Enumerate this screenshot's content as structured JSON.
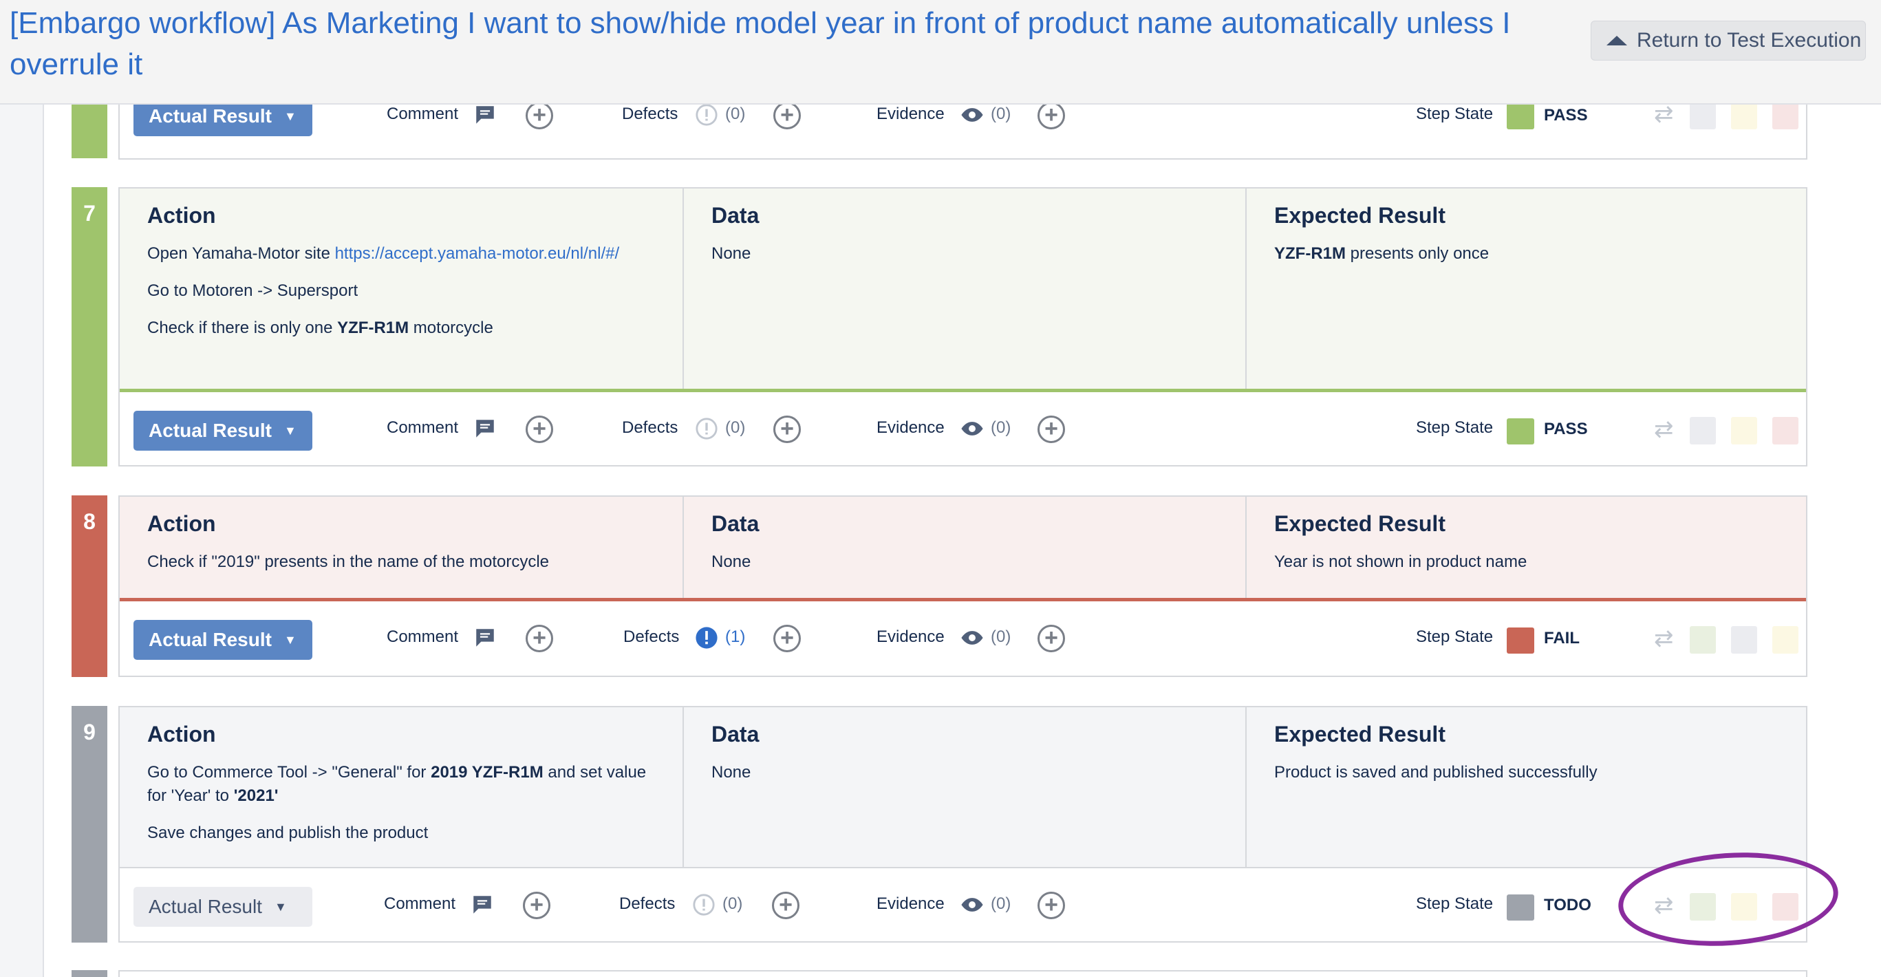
{
  "header": {
    "title": "[Embargo workflow] As Marketing I want to show/hide model year in front of product name automatically unless I overrule it",
    "return_button": "Return to Test Execution"
  },
  "labels": {
    "actual_result": "Actual Result",
    "comment": "Comment",
    "defects": "Defects",
    "evidence": "Evidence",
    "step_state": "Step State",
    "action": "Action",
    "data": "Data",
    "expected": "Expected Result"
  },
  "colors": {
    "pass": "#9fc46c",
    "fail": "#c96656",
    "todo": "#9ea3ab",
    "accent": "#5b86c4"
  },
  "step6": {
    "defects_count": "(0)",
    "evidence_count": "(0)",
    "state": "PASS"
  },
  "step7": {
    "number": "7",
    "action_prefix": "Open Yamaha-Motor site ",
    "action_link": "https://accept.yamaha-motor.eu/nl/nl/#/",
    "action_line2": "Go to Motoren -> Supersport",
    "action_line3_a": "Check if there is only one ",
    "action_line3_b": "YZF-R1M",
    "action_line3_c": " motorcycle",
    "data": "None",
    "expected_a": "YZF-R1M",
    "expected_b": " presents only once",
    "defects_count": "(0)",
    "evidence_count": "(0)",
    "state": "PASS"
  },
  "step8": {
    "number": "8",
    "action": "Check if \"2019\" presents in the name of the motorcycle",
    "data": "None",
    "expected": "Year is not shown in product name",
    "defects_count": "(1)",
    "evidence_count": "(0)",
    "state": "FAIL"
  },
  "step9": {
    "number": "9",
    "action_a": "Go to Commerce Tool -> \"General\" for ",
    "action_b": "2019 YZF-R1M",
    "action_c": "  and set  value for 'Year' to ",
    "action_d": "'2021'",
    "action_line2": "Save changes and publish the product",
    "data": "None",
    "expected": "Product is saved and published successfully",
    "defects_count": "(0)",
    "evidence_count": "(0)",
    "state": "TODO"
  }
}
